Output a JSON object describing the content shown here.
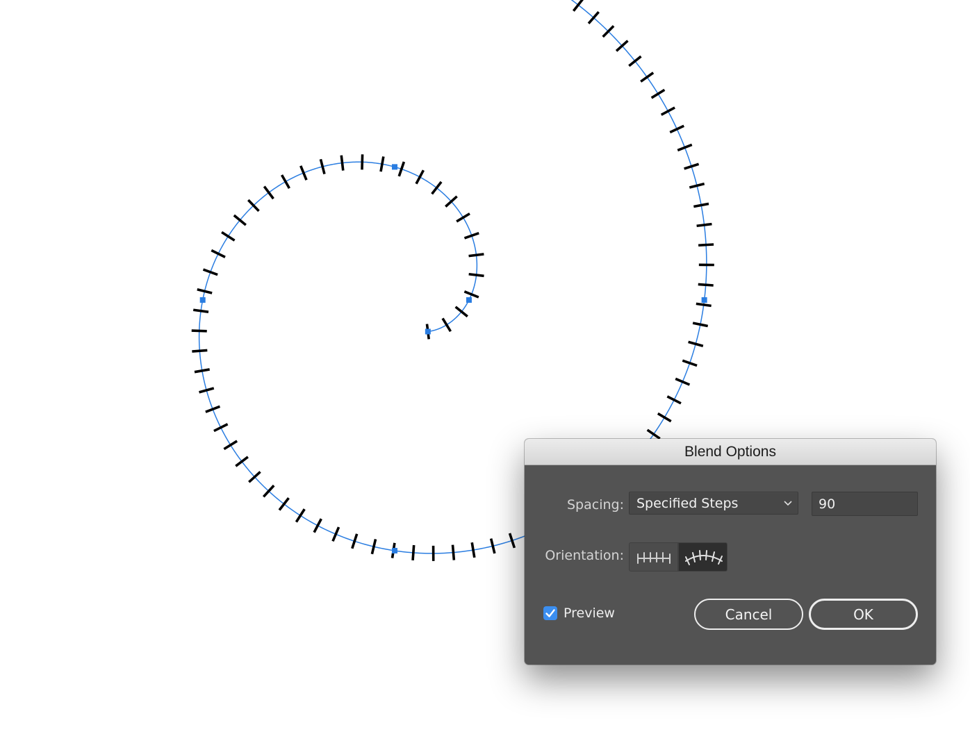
{
  "canvas": {
    "path_color": "#2a7de1",
    "step_color": "#000000",
    "blend_steps": 90
  },
  "dialog": {
    "title": "Blend Options",
    "spacing": {
      "label": "Spacing:",
      "selected": "Specified Steps",
      "steps_value": "90"
    },
    "orientation": {
      "label": "Orientation:",
      "options": [
        {
          "name": "align-to-page",
          "icon": "align-to-page-icon",
          "selected": false
        },
        {
          "name": "align-to-path",
          "icon": "align-to-path-icon",
          "selected": true
        }
      ]
    },
    "preview": {
      "label": "Preview",
      "checked": true
    },
    "buttons": {
      "cancel_label": "Cancel",
      "ok_label": "OK"
    },
    "colors": {
      "dialog_bg": "#535353",
      "checkbox_accent": "#3b8ef0"
    }
  }
}
